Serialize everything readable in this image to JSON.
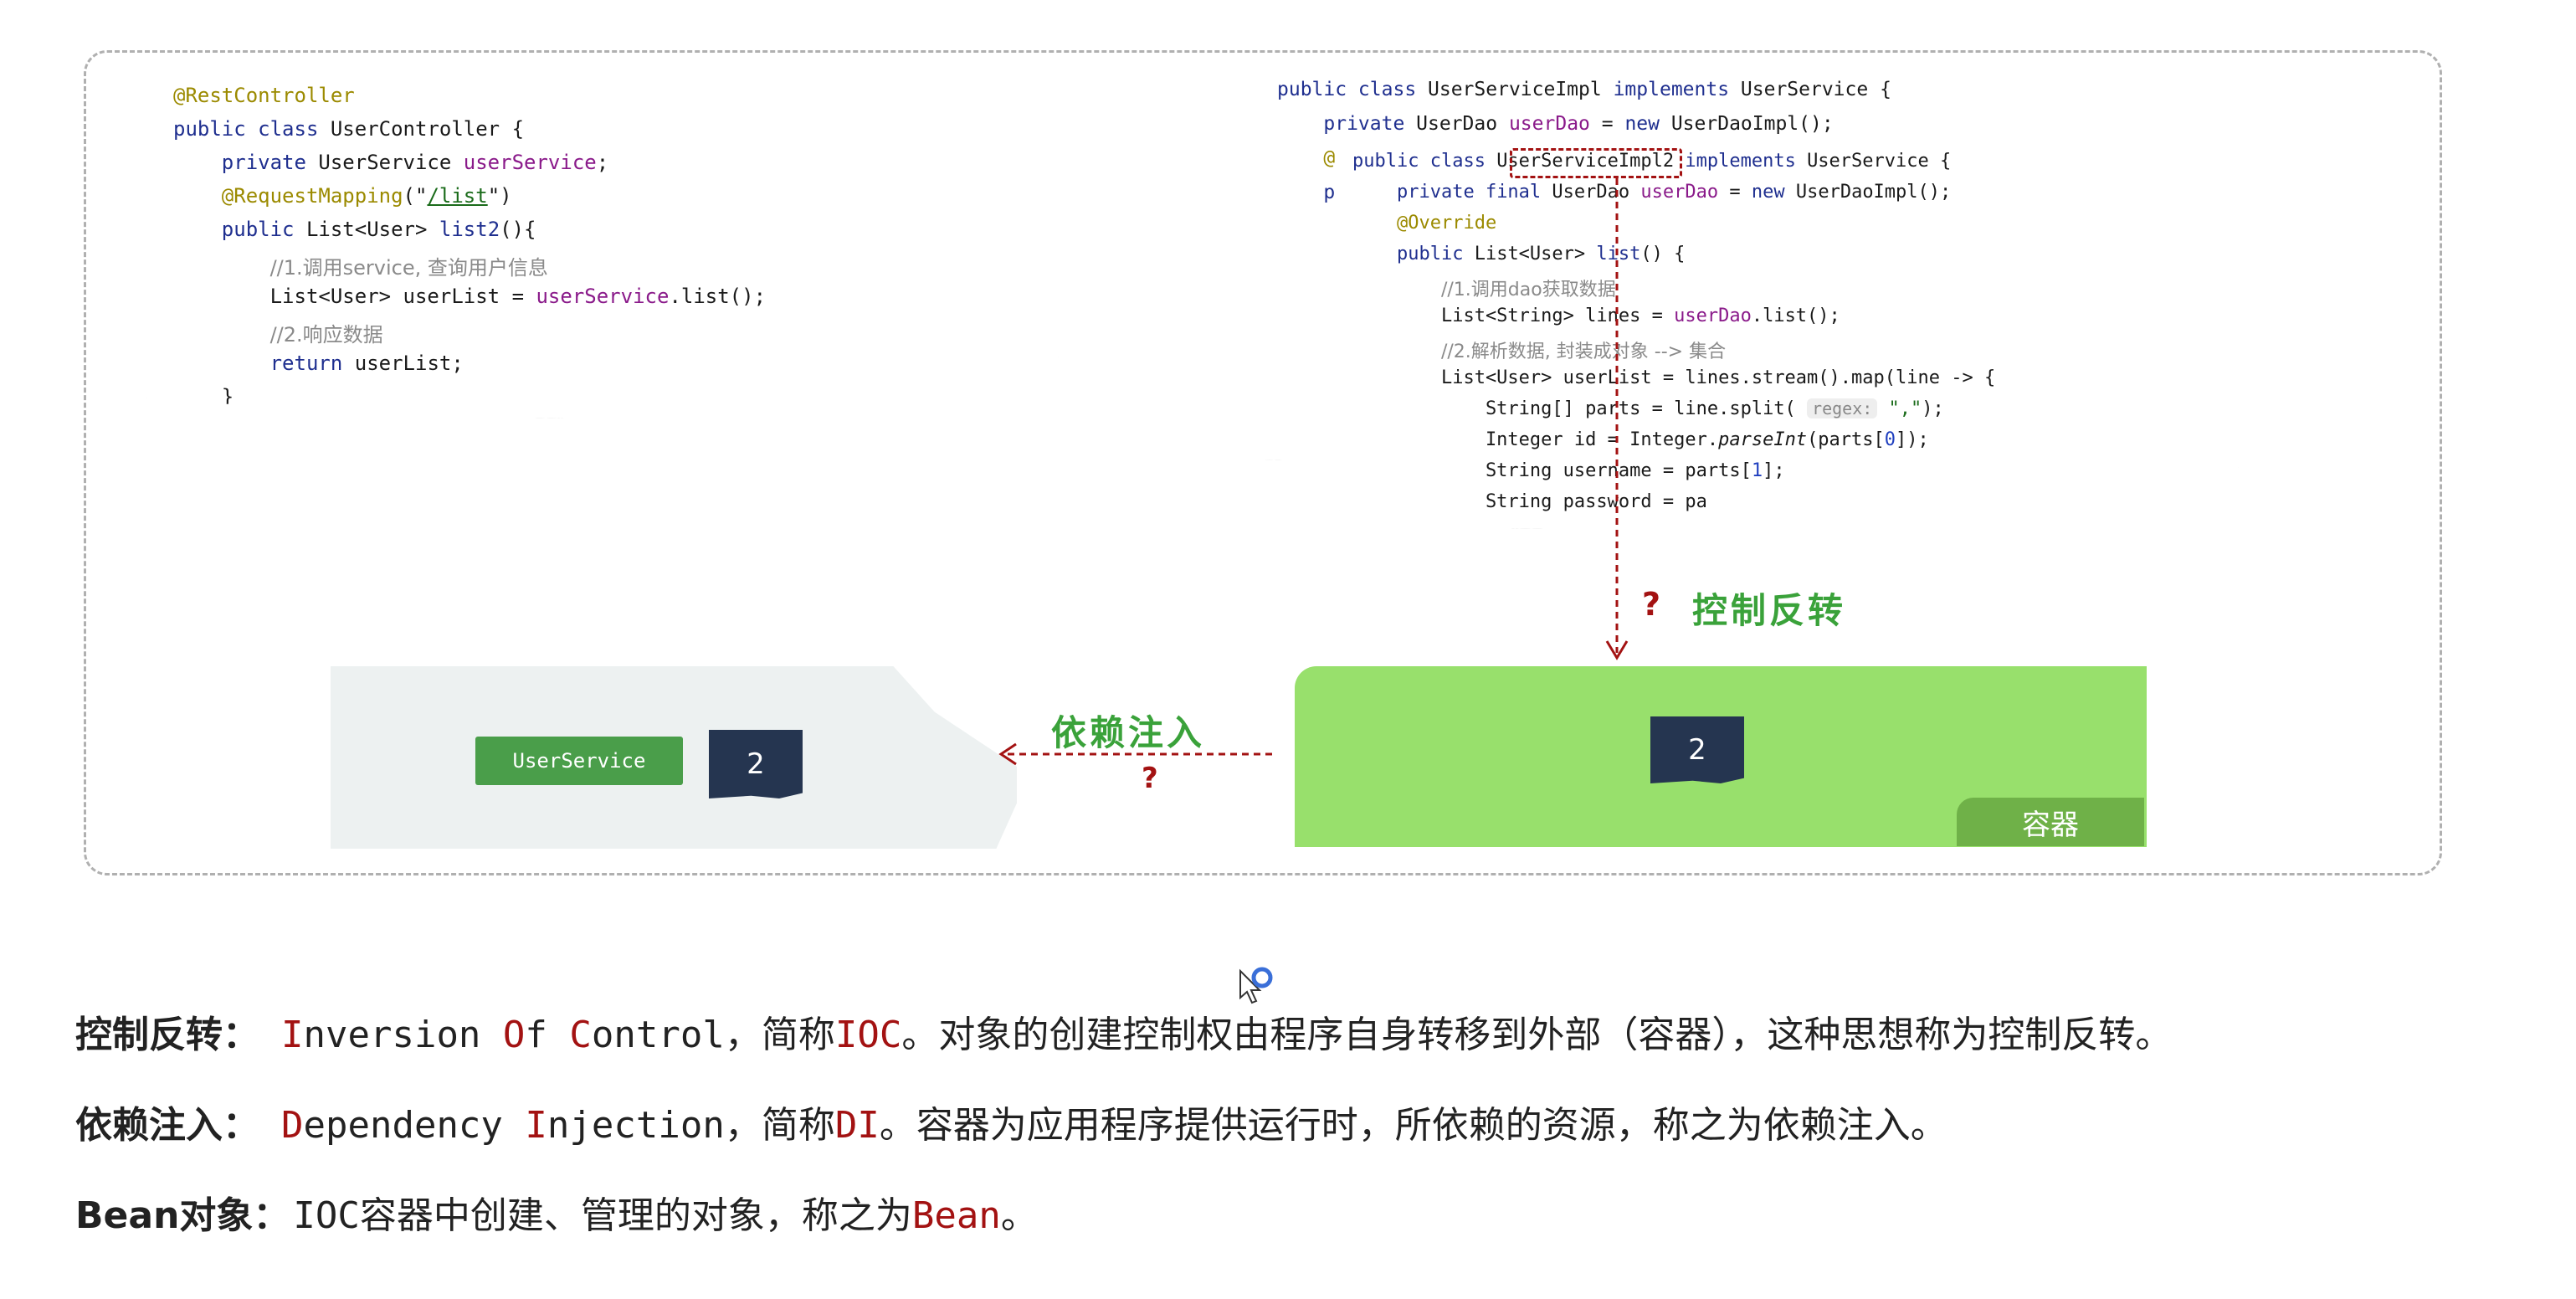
{
  "controller_code": {
    "lines": [
      [
        {
          "c": "ann",
          "t": "@RestController"
        }
      ],
      [
        {
          "c": "kw",
          "t": "public class "
        },
        {
          "t": "UserController {"
        }
      ],
      [
        {
          "t": "    "
        },
        {
          "c": "kw",
          "t": "private "
        },
        {
          "t": "UserService "
        },
        {
          "c": "fld",
          "t": "userService"
        },
        {
          "t": ";"
        }
      ],
      [
        {
          "t": "    "
        },
        {
          "c": "ann",
          "t": "@RequestMapping"
        },
        {
          "t": "(\""
        },
        {
          "c": "str",
          "t": "/list"
        },
        {
          "t": "\")"
        }
      ],
      [
        {
          "t": "    "
        },
        {
          "c": "kw",
          "t": "public "
        },
        {
          "t": "List<User> "
        },
        {
          "c": "kw",
          "t": "list2"
        },
        {
          "t": "(){"
        }
      ],
      [
        {
          "t": "        "
        },
        {
          "c": "cmt",
          "t": "//1.调用service, 查询用户信息"
        }
      ],
      [
        {
          "t": "        List<User> userList = "
        },
        {
          "c": "fld",
          "t": "userService"
        },
        {
          "t": ".list();"
        }
      ],
      [
        {
          "t": "        "
        },
        {
          "c": "cmt",
          "t": "//2.响应数据"
        }
      ],
      [
        {
          "t": "        "
        },
        {
          "c": "kw",
          "t": "return "
        },
        {
          "t": "userList;"
        }
      ],
      [
        {
          "t": "    }"
        }
      ]
    ]
  },
  "service_back_code": {
    "lines": [
      [
        {
          "c": "kw",
          "t": "public class "
        },
        {
          "t": "UserServiceImpl "
        },
        {
          "c": "kw",
          "t": "implements "
        },
        {
          "t": "UserService {"
        }
      ],
      [
        {
          "t": "    "
        },
        {
          "c": "kw",
          "t": "private "
        },
        {
          "t": "UserDao "
        },
        {
          "c": "fld",
          "t": "userDao"
        },
        {
          "t": " = "
        },
        {
          "c": "kw",
          "t": "new "
        },
        {
          "t": "UserDaoImpl();"
        }
      ],
      [
        {
          "t": "    "
        },
        {
          "c": "ann",
          "t": "@"
        }
      ],
      [
        {
          "t": "    "
        },
        {
          "c": "kw",
          "t": "p"
        }
      ]
    ]
  },
  "service_front_code": {
    "lines": [
      [
        {
          "c": "kw",
          "t": "public class "
        },
        {
          "t": "UserServiceImpl2 "
        },
        {
          "c": "kw",
          "t": "implements "
        },
        {
          "t": "UserService {"
        }
      ],
      [
        {
          "t": "    "
        },
        {
          "c": "kw",
          "t": "private final "
        },
        {
          "t": "UserDao "
        },
        {
          "c": "fld",
          "t": "userDao"
        },
        {
          "t": " = "
        },
        {
          "c": "kw",
          "t": "new "
        },
        {
          "t": "UserDaoImpl();"
        }
      ],
      [
        {
          "t": "    "
        },
        {
          "c": "ann",
          "t": "@Override"
        }
      ],
      [
        {
          "t": "    "
        },
        {
          "c": "kw",
          "t": "public "
        },
        {
          "t": "List<User> "
        },
        {
          "c": "kw",
          "t": "list"
        },
        {
          "t": "() {"
        }
      ],
      [
        {
          "t": "        "
        },
        {
          "c": "cmt",
          "t": "//1.调用dao获取数据"
        }
      ],
      [
        {
          "t": "        List<String> lines = "
        },
        {
          "c": "fld",
          "t": "userDao"
        },
        {
          "t": ".list();"
        }
      ],
      [
        {
          "t": "        "
        },
        {
          "c": "cmt",
          "t": "//2.解析数据, 封装成对象 --> 集合"
        }
      ],
      [
        {
          "t": "        List<User> userList = lines.stream().map(line -> {"
        }
      ],
      [
        {
          "t": "            String[] parts = line.split( "
        },
        {
          "c": "hint",
          "t": "regex:"
        },
        {
          "c": "str2",
          "t": " \",\""
        },
        {
          "t": ");"
        }
      ],
      [
        {
          "t": "            Integer id = Integer."
        },
        {
          "c": "it",
          "t": "parseInt"
        },
        {
          "t": "(parts["
        },
        {
          "c": "num",
          "t": "0"
        },
        {
          "t": "]);"
        }
      ],
      [
        {
          "t": "            String username = parts["
        },
        {
          "c": "num",
          "t": "1"
        },
        {
          "t": "];"
        }
      ],
      [
        {
          "t": "            String password = pa"
        }
      ]
    ]
  },
  "labels": {
    "ioc": "控制反转",
    "di": "依赖注入",
    "question": "?",
    "userservice_tag": "UserService",
    "doc_icon_left": "2",
    "doc_icon_right": "2",
    "container": "容器"
  },
  "definitions": [
    {
      "term": "控制反转：",
      "parts": [
        {
          "red": true,
          "t": "I"
        },
        {
          "t": "nversion "
        },
        {
          "red": true,
          "t": "O"
        },
        {
          "t": "f "
        },
        {
          "red": true,
          "t": "C"
        },
        {
          "t": "ontrol"
        },
        {
          "cn": true,
          "t": "，简称"
        },
        {
          "red": true,
          "t": "IOC"
        },
        {
          "cn": true,
          "t": "。对象的创建控制权由程序自身转移到外部（容器），这种思想称为控制反转。"
        }
      ]
    },
    {
      "term": "依赖注入：",
      "parts": [
        {
          "red": true,
          "t": "D"
        },
        {
          "t": "ependency "
        },
        {
          "red": true,
          "t": "I"
        },
        {
          "t": "njection"
        },
        {
          "cn": true,
          "t": "，简称"
        },
        {
          "red": true,
          "t": "DI"
        },
        {
          "cn": true,
          "t": "。容器为应用程序提供运行时，所依赖的资源，称之为依赖注入。"
        }
      ]
    },
    {
      "term": "Bean对象：",
      "parts": [
        {
          "t": "IOC"
        },
        {
          "cn": true,
          "t": "容器中创建、管理的对象，称之为"
        },
        {
          "red": true,
          "t": "Bean"
        },
        {
          "cn": true,
          "t": "。"
        }
      ]
    }
  ],
  "colors": {
    "accent_red": "#a31212",
    "container_green": "#98e06c",
    "tag_green": "#4a9e4a",
    "doc_navy": "#253550"
  }
}
